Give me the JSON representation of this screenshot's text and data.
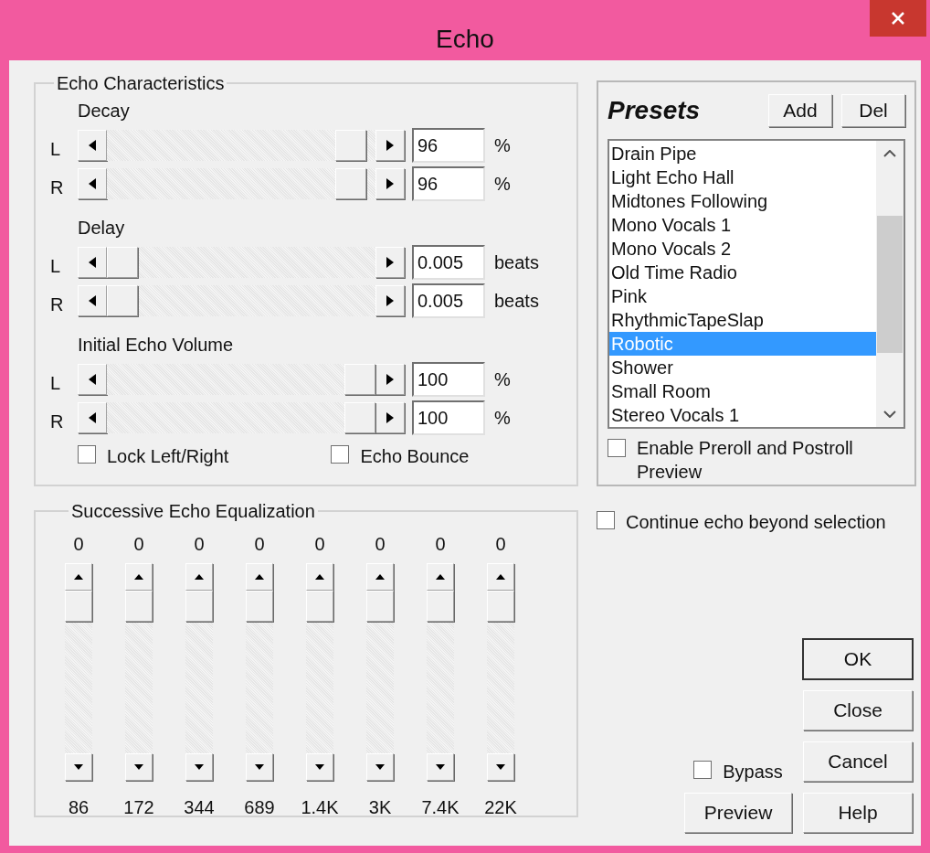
{
  "window": {
    "title": "Echo"
  },
  "echo_characteristics": {
    "title": "Echo Characteristics",
    "groups": [
      {
        "label": "Decay",
        "channels": [
          {
            "channel": "L",
            "level": 0.96,
            "value": "96",
            "unit": "%"
          },
          {
            "channel": "R",
            "level": 0.96,
            "value": "96",
            "unit": "%"
          }
        ]
      },
      {
        "label": "Delay",
        "channels": [
          {
            "channel": "L",
            "level": 0,
            "value": "0.005",
            "unit": "beats"
          },
          {
            "channel": "R",
            "level": 0,
            "value": "0.005",
            "unit": "beats"
          }
        ]
      },
      {
        "label": "Initial Echo Volume",
        "channels": [
          {
            "channel": "L",
            "level": 1,
            "value": "100",
            "unit": "%"
          },
          {
            "channel": "R",
            "level": 1,
            "value": "100",
            "unit": "%"
          }
        ]
      }
    ],
    "checkboxes": [
      {
        "label": "Lock Left/Right",
        "checked": false
      },
      {
        "label": "Echo Bounce",
        "checked": false
      }
    ]
  },
  "presets": {
    "title": "Presets",
    "buttons": [
      "Add",
      "Del"
    ],
    "items": [
      {
        "label": "Drain Pipe",
        "selected": false
      },
      {
        "label": "Light Echo Hall",
        "selected": false
      },
      {
        "label": "Midtones Following",
        "selected": false
      },
      {
        "label": "Mono Vocals 1",
        "selected": false
      },
      {
        "label": "Mono Vocals 2",
        "selected": false
      },
      {
        "label": "Old Time Radio",
        "selected": false
      },
      {
        "label": "Pink",
        "selected": false
      },
      {
        "label": "RhythmicTapeSlap",
        "selected": false
      },
      {
        "label": "Robotic",
        "selected": true
      },
      {
        "label": "Shower",
        "selected": false
      },
      {
        "label": "Small Room",
        "selected": false
      },
      {
        "label": "Stereo Vocals 1",
        "selected": false
      }
    ],
    "preview_checkbox": {
      "label": "Enable Preroll and Postroll Preview",
      "checked": false
    }
  },
  "continue_checkbox": {
    "label": "Continue echo beyond selection",
    "checked": false
  },
  "equalization": {
    "title": "Successive Echo Equalization",
    "bands": [
      {
        "value": "0",
        "level": 1,
        "frequency": "86"
      },
      {
        "value": "0",
        "level": 1,
        "frequency": "172"
      },
      {
        "value": "0",
        "level": 1,
        "frequency": "344"
      },
      {
        "value": "0",
        "level": 1,
        "frequency": "689"
      },
      {
        "value": "0",
        "level": 1,
        "frequency": "1.4K"
      },
      {
        "value": "0",
        "level": 1,
        "frequency": "3K"
      },
      {
        "value": "0",
        "level": 1,
        "frequency": "7.4K"
      },
      {
        "value": "0",
        "level": 1,
        "frequency": "22K"
      }
    ]
  },
  "bypass": {
    "label": "Bypass",
    "checked": false
  },
  "preview_button": "Preview",
  "buttons": [
    {
      "label": "OK",
      "default": true
    },
    {
      "label": "Close",
      "default": false
    },
    {
      "label": "Cancel",
      "default": false
    },
    {
      "label": "Help",
      "default": false
    }
  ]
}
